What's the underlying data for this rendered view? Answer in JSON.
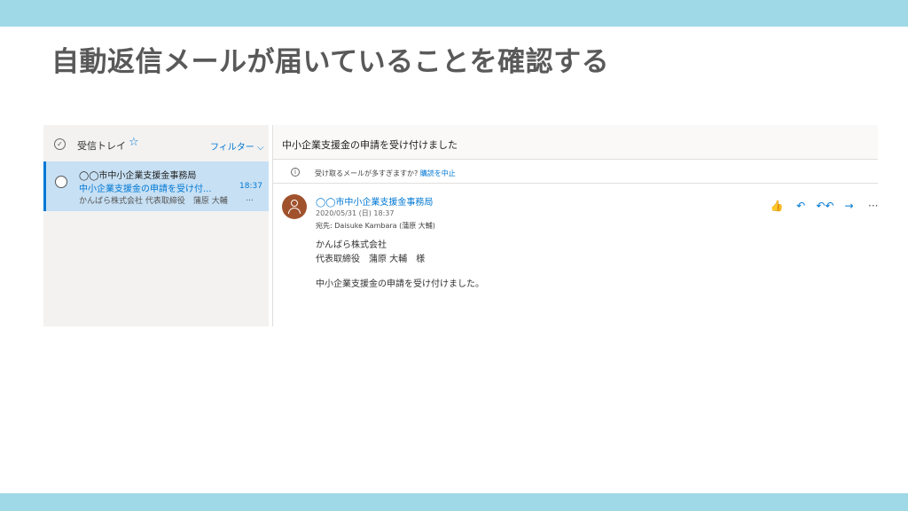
{
  "slide": {
    "title": "自動返信メールが届いていることを確認する"
  },
  "colors": {
    "band": "#9fd8e6",
    "accent": "#0078d4",
    "avatar": "#a0522d",
    "selected_row": "#c7e0f4"
  },
  "list": {
    "folder_label": "受信トレイ",
    "favorite_icon": "star-icon",
    "filter_label": "フィルター ⌵",
    "messages": [
      {
        "sender": "◯◯市中小企業支援金事務局",
        "subject": "中小企業支援金の申請を受け付...",
        "time": "18:37",
        "preview": "かんばら株式会社 代表取締役　蒲原 大輔",
        "ellipsis": "..."
      }
    ]
  },
  "reading": {
    "subject": "中小企業支援金の申請を受け付けました",
    "info_text": "受け取るメールが多すぎますか? ",
    "info_link": "購読を中止",
    "from": "◯◯市中小企業支援金事務局",
    "date": "2020/05/31 (日) 18:37",
    "to": "宛先: Daisuke Kambara (蒲原 大輔)",
    "body": [
      "かんばら株式会社",
      "代表取締役　蒲原 大輔　様",
      "中小企業支援金の申請を受け付けました。"
    ],
    "actions": {
      "like": "👍",
      "reply": "↶",
      "reply_all": "↶↶",
      "forward": "→",
      "more": "···"
    }
  }
}
